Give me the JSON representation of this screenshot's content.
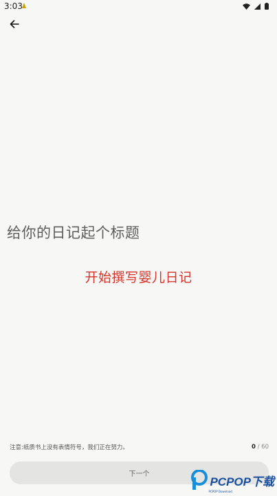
{
  "status_bar": {
    "time": "3:03",
    "icons": [
      "wifi-icon",
      "signal-icon",
      "battery-icon"
    ]
  },
  "header": {
    "back_icon": "arrow-left-icon"
  },
  "main": {
    "title_prompt": "给你的日记起个标题",
    "overlay_text": "开始撰写婴儿日记"
  },
  "footer": {
    "notice": "注意:纸质书上没有表情符号，我们正在努力。",
    "counter_current": "0",
    "counter_separator": " / ",
    "counter_max": "60",
    "next_label": "下一个"
  },
  "watermark": {
    "text": "PCPOP下载",
    "sub": "PCPOP Download"
  },
  "colors": {
    "background": "#f7f7f5",
    "overlay_red": "#d4342a",
    "button_bg": "#e4e4e2",
    "watermark_blue": "#1a4fa0"
  }
}
